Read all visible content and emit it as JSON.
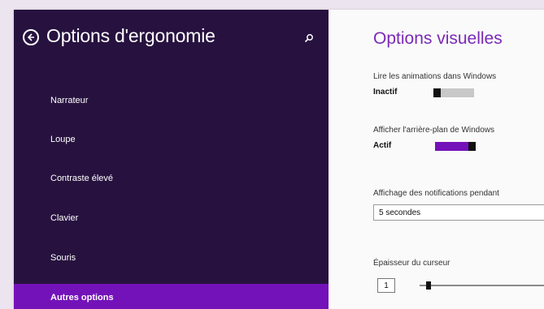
{
  "sidebar": {
    "title": "Options d'ergonomie",
    "items": [
      {
        "label": "Narrateur"
      },
      {
        "label": "Loupe"
      },
      {
        "label": "Contraste élevé"
      },
      {
        "label": "Clavier"
      },
      {
        "label": "Souris"
      },
      {
        "label": "Autres options"
      }
    ],
    "active_item": "Autres options"
  },
  "content": {
    "title": "Options visuelles",
    "animations": {
      "label": "Lire les animations dans Windows",
      "state": "Inactif",
      "on": false
    },
    "background": {
      "label": "Afficher l'arrière-plan de Windows",
      "state": "Actif",
      "on": true
    },
    "notifications": {
      "label": "Affichage des notifications pendant",
      "value": "5 secondes"
    },
    "cursor": {
      "label": "Épaisseur du curseur",
      "value": "1",
      "slider_fraction": 0.05
    }
  },
  "colors": {
    "sidebar_bg": "#27123f",
    "accent": "#7412ba",
    "content_bg": "#fafafa"
  },
  "icons": [
    "back-arrow-icon",
    "search-icon"
  ]
}
